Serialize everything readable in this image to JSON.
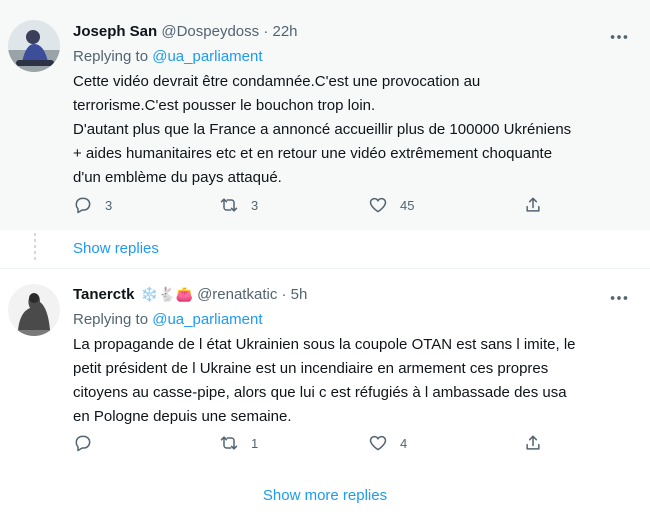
{
  "tweets": [
    {
      "name": "Joseph San",
      "handle": "@Dospeydoss",
      "separator": "·",
      "time": "22h",
      "replying_prefix": "Replying to",
      "replying_to": "@ua_parliament",
      "body_lines": [
        "Cette vidéo devrait être condamnée.C'est une provocation au",
        "terrorisme.C'est pousser le bouchon trop loin.",
        "D'autant plus que la France a annoncé accueillir plus de 100000 Ukréniens",
        "+ aides humanitaires etc et en retour une vidéo extrêmement choquante",
        "d'un emblème du pays attaqué."
      ],
      "replies": "3",
      "retweets": "3",
      "likes": "45"
    },
    {
      "name": "Tanerctk",
      "emojis": "❄️🐇👛",
      "handle": "@renatkatic",
      "separator": "·",
      "time": "5h",
      "replying_prefix": "Replying to",
      "replying_to": "@ua_parliament",
      "body_lines": [
        "La propagande de l état Ukrainien sous la coupole OTAN est sans l imite, le",
        "petit président de l Ukraine est un incendiaire en armement ces propres",
        "citoyens au casse-pipe, alors que lui c est réfugiés à l ambassade des usa",
        "en Pologne depuis une semaine."
      ],
      "replies": "",
      "retweets": "1",
      "likes": "4"
    }
  ],
  "show_replies": "Show replies",
  "show_more_replies": "Show more replies",
  "colors": {
    "link": "#1d9bf0",
    "secondary": "#536471",
    "text": "#0f1419",
    "highlight_bg": "#f7f9f9"
  }
}
